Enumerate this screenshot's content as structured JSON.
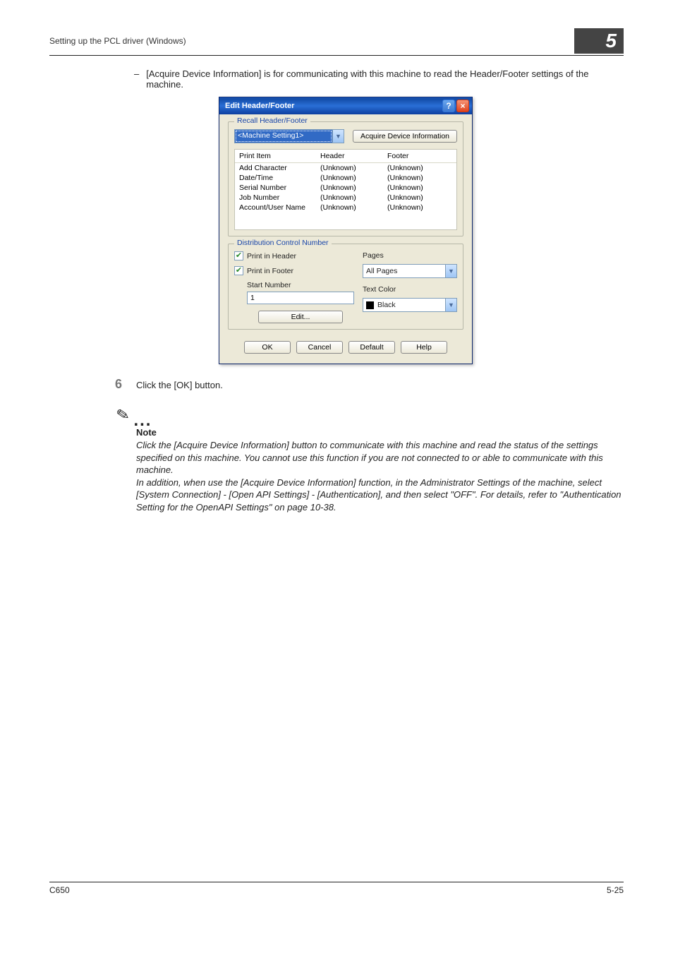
{
  "header": {
    "breadcrumb": "Setting up the PCL driver (Windows)",
    "chapter": "5"
  },
  "body": {
    "bullet_text": "[Acquire Device Information] is for communicating with this machine to read the Header/Footer settings of the machine.",
    "step_num": "6",
    "step_text": "Click the [OK] button.",
    "note_label": "Note",
    "note_p1": "Click the [Acquire Device Information] button to communicate with this machine and read the status of the settings specified on this machine. You cannot use this function if you are not connected to or able to communicate with this machine.",
    "note_p2": "In addition, when use the [Acquire Device Information] function, in the Administrator Settings of the machine, select [System Connection] - [Open API Settings] - [Authentication], and then select \"OFF\". For details, refer to \"Authentication Setting for the OpenAPI Settings\" on page 10-38."
  },
  "dialog": {
    "title": "Edit Header/Footer",
    "recall_legend": "Recall Header/Footer",
    "recall_value": "<Machine Setting1>",
    "acquire_btn": "Acquire Device Information",
    "table": {
      "headers": [
        "Print Item",
        "Header",
        "Footer"
      ],
      "rows": [
        [
          "Add Character",
          "(Unknown)",
          "(Unknown)"
        ],
        [
          "Date/Time",
          "(Unknown)",
          "(Unknown)"
        ],
        [
          "Serial Number",
          "(Unknown)",
          "(Unknown)"
        ],
        [
          "Job Number",
          "(Unknown)",
          "(Unknown)"
        ],
        [
          "Account/User Name",
          "(Unknown)",
          "(Unknown)"
        ]
      ]
    },
    "dist_legend": "Distribution Control Number",
    "chk_header": "Print in Header",
    "chk_footer": "Print in Footer",
    "start_label": "Start Number",
    "start_value": "1",
    "edit_btn": "Edit...",
    "pages_label": "Pages",
    "pages_value": "All Pages",
    "color_label": "Text Color",
    "color_value": "Black",
    "ok": "OK",
    "cancel": "Cancel",
    "default": "Default",
    "help": "Help"
  },
  "footer": {
    "left": "C650",
    "right": "5-25"
  }
}
